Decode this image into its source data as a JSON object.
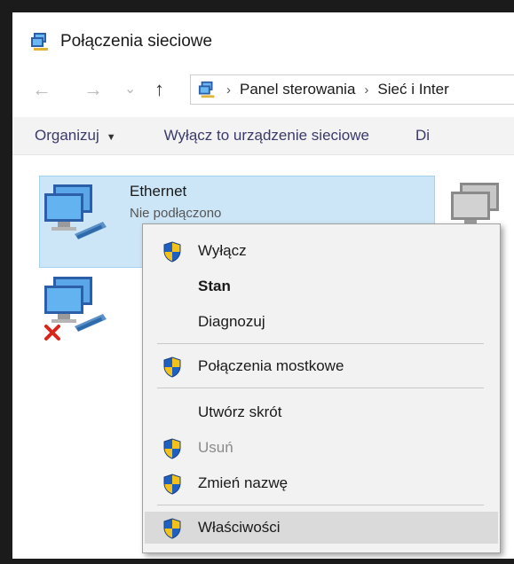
{
  "window": {
    "title": "Połączenia sieciowe"
  },
  "nav": {
    "back_glyph": "←",
    "forward_glyph": "→",
    "recent_glyph": "⌄",
    "up_glyph": "↑",
    "breadcrumb": [
      "Panel sterowania",
      "Sieć i Inter"
    ],
    "separator": "›"
  },
  "toolbar": {
    "organize": "Organizuj",
    "disable_device": "Wyłącz to urządzenie sieciowe",
    "diagnose_partial": "Di"
  },
  "items": {
    "ethernet": {
      "name": "Ethernet",
      "status_partial": "Nie podłączono"
    }
  },
  "context_menu": {
    "disable": "Wyłącz",
    "status": "Stan",
    "diagnose": "Diagnozuj",
    "bridge": "Połączenia mostkowe",
    "shortcut": "Utwórz skrót",
    "delete": "Usuń",
    "rename": "Zmień nazwę",
    "properties": "Właściwości"
  },
  "icons": {
    "shield": "uac-shield-icon",
    "network": "network-adapter-icon",
    "error": "red-x-icon"
  },
  "colors": {
    "selection": "#cde6f7",
    "menu_bg": "#f2f2f2",
    "menu_highlight": "#dadada",
    "shield_blue": "#1f5fbf",
    "shield_yellow": "#f2c21b",
    "error_red": "#d8261c"
  }
}
